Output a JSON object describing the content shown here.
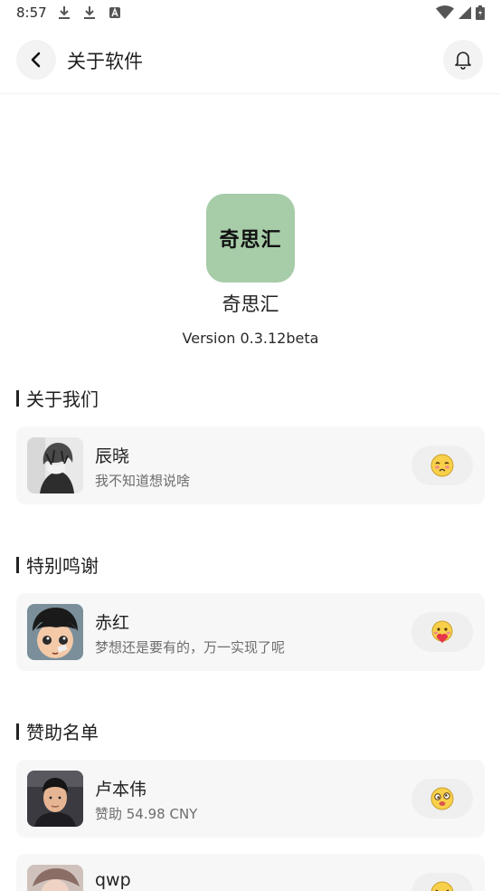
{
  "status_bar": {
    "time": "8:57",
    "left_icons": [
      "download-icon",
      "download-icon",
      "a-icon"
    ],
    "right_icons": [
      "wifi-icon",
      "signal-icon",
      "battery-icon"
    ]
  },
  "header": {
    "title": "关于软件",
    "back_icon": "chevron-left-icon",
    "bell_icon": "bell-icon"
  },
  "app": {
    "logo_text": "奇思汇",
    "logo_color": "#a6cca8",
    "name": "奇思汇",
    "version": "Version 0.3.12beta"
  },
  "sections": [
    {
      "title": "关于我们",
      "items": [
        {
          "name": "辰晓",
          "desc": "我不知道想说啥",
          "emoji": "shy-face-icon"
        }
      ]
    },
    {
      "title": "特别鸣谢",
      "items": [
        {
          "name": "赤红",
          "desc": "梦想还是要有的，万一实现了呢",
          "emoji": "heart-face-icon"
        }
      ]
    },
    {
      "title": "赞助名单",
      "items": [
        {
          "name": "卢本伟",
          "desc": "赞助 54.98 CNY",
          "emoji": "dizzy-face-icon"
        },
        {
          "name": "qwp",
          "desc": "",
          "emoji": "laughing-face-icon"
        }
      ]
    }
  ]
}
